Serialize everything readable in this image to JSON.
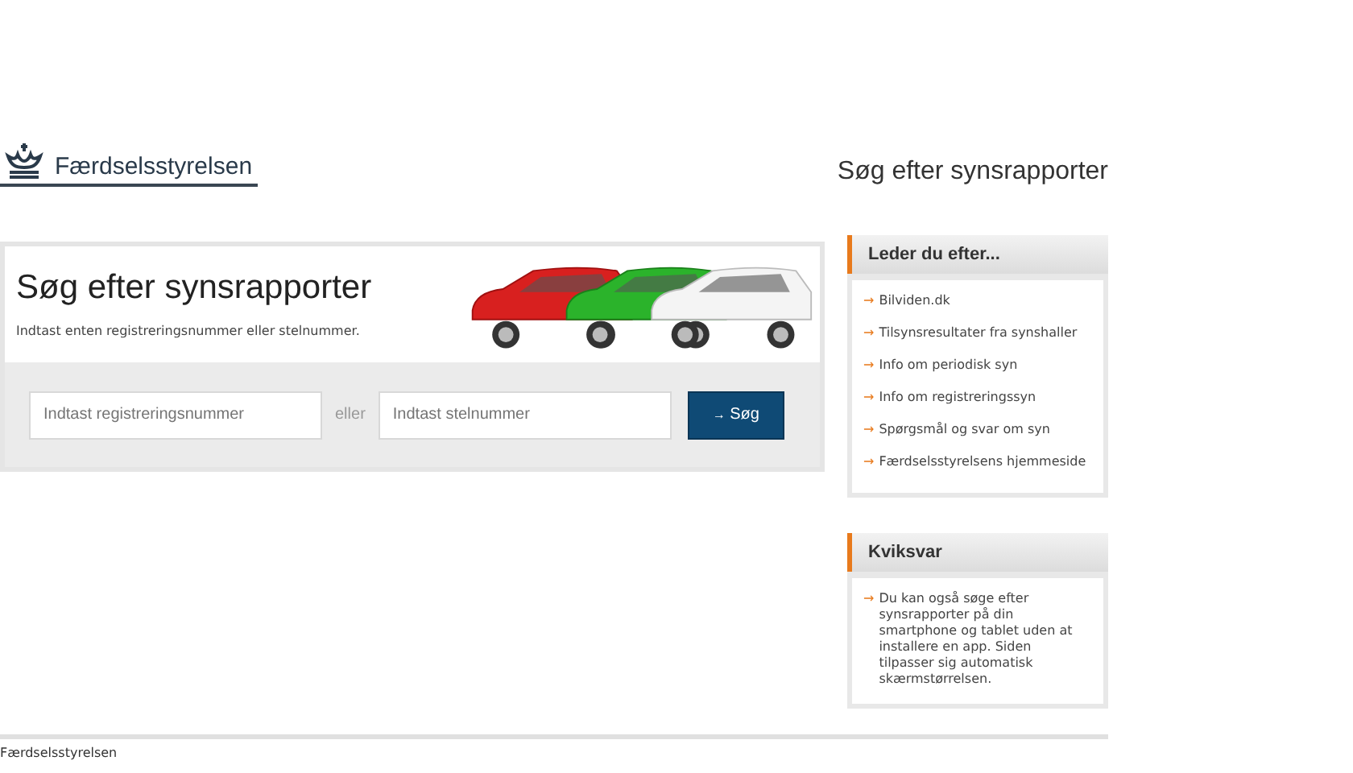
{
  "header": {
    "logo_text": "Færdselsstyrelsen",
    "page_title": "Søg efter synsrapporter"
  },
  "search_panel": {
    "heading": "Søg efter synsrapporter",
    "intro": "Indtast enten registreringsnummer eller stelnummer.",
    "registration_field": {
      "placeholder": "Indtast registreringsnummer"
    },
    "separator": "eller",
    "chassis_field": {
      "placeholder": "Indtast stelnummer"
    },
    "button": {
      "icon": "→",
      "label": "Søg"
    }
  },
  "sidebar": [
    {
      "title": "Leder du efter...",
      "kind": "links",
      "items": [
        {
          "icon": "→",
          "text": "Bilviden.dk"
        },
        {
          "icon": "→",
          "text": "Tilsynsresultater fra synshaller"
        },
        {
          "icon": "→",
          "text": "Info om periodisk syn"
        },
        {
          "icon": "→",
          "text": "Info om registreringssyn"
        },
        {
          "icon": "→",
          "text": "Spørgsmål og svar om syn"
        },
        {
          "icon": "→",
          "text": "Færdselsstyrelsens hjemmeside"
        }
      ]
    },
    {
      "title": "Kviksvar",
      "kind": "text",
      "items": [
        {
          "icon": "→",
          "text": "Du kan også søge efter synsrapporter på din smartphone og tablet uden at installere en app. Siden tilpasser sig automatisk skærmstørrelsen."
        }
      ]
    }
  ],
  "footer": {
    "text": "Færdselsstyrelsen"
  }
}
